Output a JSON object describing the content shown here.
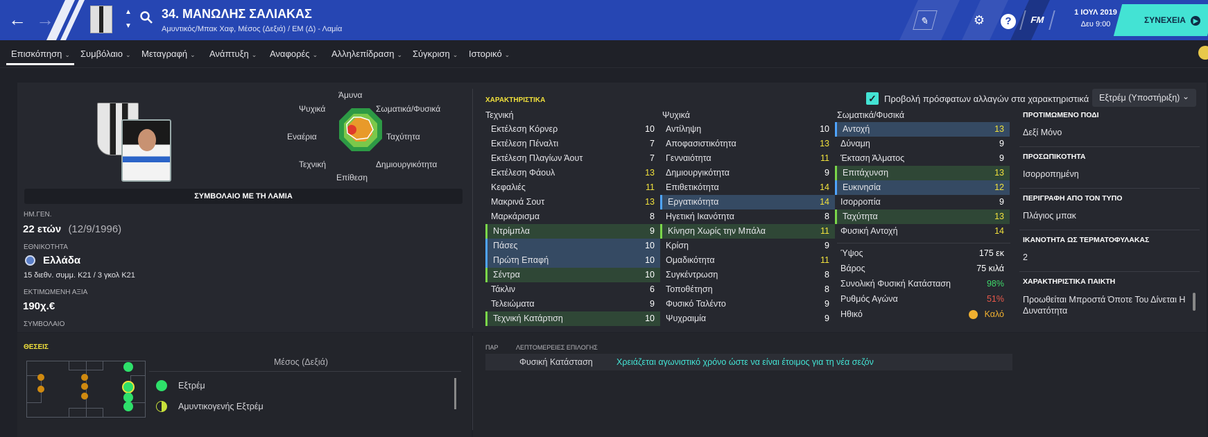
{
  "header": {
    "player_name": "34. ΜΑΝΩΛΗΣ ΣΑΛΙΑΚΑΣ",
    "player_sub": "Αμυντικός/Μπακ Χαφ, Μέσος (Δεξιά) / ΕΜ (Δ) - Λαμία",
    "date": "1 ΙΟΥΛ 2019",
    "time": "Δευ 9:00",
    "game_logo": "FM",
    "continue_label": "ΣΥΝΕΧΕΙΑ"
  },
  "tabs": [
    {
      "label": "Επισκόπηση"
    },
    {
      "label": "Συμβόλαιο"
    },
    {
      "label": "Μεταγραφή"
    },
    {
      "label": "Ανάπτυξη"
    },
    {
      "label": "Αναφορές"
    },
    {
      "label": "Αλληλεπίδραση"
    },
    {
      "label": "Σύγκριση"
    },
    {
      "label": "Ιστορικό"
    }
  ],
  "radar": {
    "labels": [
      "Άμυνα",
      "Σωματικά/Φυσικά",
      "Ταχύτητα",
      "Δημιουργικότητα",
      "Επίθεση",
      "Τεχνική",
      "Εναέρια",
      "Ψυχικά"
    ]
  },
  "profile": {
    "contract_banner": "ΣΥΜΒΟΛΑΙΟ ΜΕ ΤΗ ΛΑΜΙΑ",
    "dob_label": "ΗΜ.ΓΕΝ.",
    "age": "22 ετών",
    "dob": "(12/9/1996)",
    "nationality_label": "ΕΘΝΙΚΟΤΗΤΑ",
    "nationality": "Ελλάδα",
    "caps": "15 διεθν. συμμ. K21 / 3 γκολ K21",
    "value_label": "ΕΚΤΙΜΩΜΕΝΗ ΑΞΙΑ",
    "value": "190χ.€",
    "contract_label": "ΣΥΜΒΟΛΑΙΟ"
  },
  "attributes": {
    "title": "ΧΑΡΑΚΤΗΡΙΣΤΙΚΑ",
    "recent_changes_label": "Προβολή πρόσφατων αλλαγών στα χαρακτηριστικά",
    "role_select": "Εξτρέμ (Υποστήριξη)",
    "technical_head": "Τεχνική",
    "mental_head": "Ψυχικά",
    "physical_head": "Σωματικά/Φυσικά",
    "technical": [
      {
        "name": "Εκτέλεση Κόρνερ",
        "value": "10",
        "hl": ""
      },
      {
        "name": "Εκτέλεση Πέναλτι",
        "value": "7",
        "hl": ""
      },
      {
        "name": "Εκτέλεση Πλαγίων Άουτ",
        "value": "7",
        "hl": ""
      },
      {
        "name": "Εκτέλεση Φάουλ",
        "value": "13",
        "hl": ""
      },
      {
        "name": "Κεφαλιές",
        "value": "11",
        "hl": ""
      },
      {
        "name": "Μακρινά Σουτ",
        "value": "13",
        "hl": ""
      },
      {
        "name": "Μαρκάρισμα",
        "value": "8",
        "hl": ""
      },
      {
        "name": "Ντρίμπλα",
        "value": "9",
        "hl": "green"
      },
      {
        "name": "Πάσες",
        "value": "10",
        "hl": "blue"
      },
      {
        "name": "Πρώτη Επαφή",
        "value": "10",
        "hl": "blue"
      },
      {
        "name": "Σέντρα",
        "value": "10",
        "hl": "green"
      },
      {
        "name": "Τάκλιν",
        "value": "6",
        "hl": ""
      },
      {
        "name": "Τελειώματα",
        "value": "9",
        "hl": ""
      },
      {
        "name": "Τεχνική Κατάρτιση",
        "value": "10",
        "hl": "green"
      }
    ],
    "mental": [
      {
        "name": "Αντίληψη",
        "value": "10",
        "hl": ""
      },
      {
        "name": "Αποφασιστικότητα",
        "value": "13",
        "hl": ""
      },
      {
        "name": "Γενναιότητα",
        "value": "11",
        "hl": ""
      },
      {
        "name": "Δημιουργικότητα",
        "value": "9",
        "hl": ""
      },
      {
        "name": "Επιθετικότητα",
        "value": "14",
        "hl": ""
      },
      {
        "name": "Εργατικότητα",
        "value": "14",
        "hl": "blue"
      },
      {
        "name": "Ηγετική Ικανότητα",
        "value": "8",
        "hl": ""
      },
      {
        "name": "Κίνηση Χωρίς την Μπάλα",
        "value": "11",
        "hl": "green"
      },
      {
        "name": "Κρίση",
        "value": "9",
        "hl": ""
      },
      {
        "name": "Ομαδικότητα",
        "value": "11",
        "hl": ""
      },
      {
        "name": "Συγκέντρωση",
        "value": "8",
        "hl": ""
      },
      {
        "name": "Τοποθέτηση",
        "value": "8",
        "hl": ""
      },
      {
        "name": "Φυσικό Ταλέντο",
        "value": "9",
        "hl": ""
      },
      {
        "name": "Ψυχραιμία",
        "value": "9",
        "hl": ""
      }
    ],
    "physical": [
      {
        "name": "Αντοχή",
        "value": "13",
        "hl": "blue"
      },
      {
        "name": "Δύναμη",
        "value": "9",
        "hl": ""
      },
      {
        "name": "Έκταση Άλματος",
        "value": "9",
        "hl": ""
      },
      {
        "name": "Επιτάχυνση",
        "value": "13",
        "hl": "green"
      },
      {
        "name": "Ευκινησία",
        "value": "12",
        "hl": "blue"
      },
      {
        "name": "Ισορροπία",
        "value": "9",
        "hl": ""
      },
      {
        "name": "Ταχύτητα",
        "value": "13",
        "hl": "green"
      },
      {
        "name": "Φυσική Αντοχή",
        "value": "14",
        "hl": ""
      }
    ],
    "info": [
      {
        "name": "Ύψος",
        "value": "175 εκ",
        "color": "#ffffff"
      },
      {
        "name": "Βάρος",
        "value": "75 κιλά",
        "color": "#ffffff"
      },
      {
        "name": "Συνολική Φυσική Κατάσταση",
        "value": "98%",
        "color": "#3fd86a"
      },
      {
        "name": "Ρυθμός Αγώνα",
        "value": "51%",
        "color": "#e8584a"
      },
      {
        "name": "Ηθικό",
        "value": "Καλό",
        "color": "#f0b030"
      }
    ]
  },
  "right": [
    {
      "label": "ΠΡΟΤΙΜΩΜΕΝΟ ΠΟΔΙ",
      "value": "Δεξί Μόνο"
    },
    {
      "label": "ΠΡΟΣΩΠΙΚΟΤΗΤΑ",
      "value": "Ισορροπημένη"
    },
    {
      "label": "ΠΕΡΙΓΡΑΦΗ ΑΠΟ ΤΟΝ ΤΥΠΟ",
      "value": "Πλάγιος μπακ"
    },
    {
      "label": "ΙΚΑΝΟΤΗΤΑ ΩΣ ΤΕΡΜΑΤΟΦΥΛΑΚΑΣ",
      "value": "2"
    },
    {
      "label": "ΧΑΡΑΚΤΗΡΙΣΤΙΚΑ ΠΑΙΚΤΗ",
      "value": "Προωθείται Μπροστά Όποτε Του Δίνεται Η Δυνατότητα"
    }
  ],
  "positions": {
    "title": "ΘΕΣΕΙΣ",
    "current": "Μέσος (Δεξιά)",
    "roles": [
      {
        "name": "Εξτρέμ"
      },
      {
        "name": "Αμυντικογενής Εξτρέμ"
      }
    ]
  },
  "selection": {
    "col1": "ΠΑΡ",
    "col2": "ΛΕΠΤΟΜΕΡΕΙΕΣ ΕΠΙΛΟΓΗΣ",
    "row_label": "Φυσική Κατάσταση",
    "row_text": "Χρειάζεται αγωνιστικό χρόνο ώστε να είναι έτοιμος για τη νέα σεζόν"
  },
  "colors": {
    "accent": "#2646b3",
    "continue": "#43e3d4",
    "highlight": "#f0e03c"
  }
}
